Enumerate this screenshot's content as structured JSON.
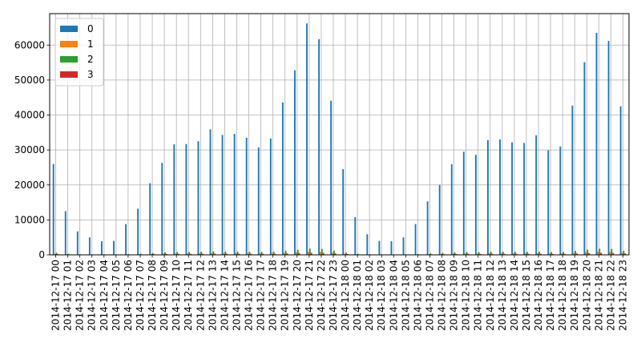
{
  "chart_data": {
    "type": "bar",
    "title": "",
    "xlabel": "",
    "ylabel": "",
    "ylim": [
      0,
      69000
    ],
    "y_ticks": [
      0,
      10000,
      20000,
      30000,
      40000,
      50000,
      60000
    ],
    "grid": true,
    "legend_position": "top-left",
    "categories": [
      "2014-12-17 00",
      "2014-12-17 01",
      "2014-12-17 02",
      "2014-12-17 03",
      "2014-12-17 04",
      "2014-12-17 05",
      "2014-12-17 06",
      "2014-12-17 07",
      "2014-12-17 08",
      "2014-12-17 09",
      "2014-12-17 10",
      "2014-12-17 11",
      "2014-12-17 12",
      "2014-12-17 13",
      "2014-12-17 14",
      "2014-12-17 15",
      "2014-12-17 16",
      "2014-12-17 17",
      "2014-12-17 18",
      "2014-12-17 19",
      "2014-12-17 20",
      "2014-12-17 21",
      "2014-12-17 22",
      "2014-12-17 23",
      "2014-12-18 00",
      "2014-12-18 01",
      "2014-12-18 02",
      "2014-12-18 03",
      "2014-12-18 04",
      "2014-12-18 05",
      "2014-12-18 06",
      "2014-12-18 07",
      "2014-12-18 08",
      "2014-12-18 09",
      "2014-12-18 10",
      "2014-12-18 11",
      "2014-12-18 12",
      "2014-12-18 13",
      "2014-12-18 14",
      "2014-12-18 15",
      "2014-12-18 16",
      "2014-12-18 17",
      "2014-12-18 18",
      "2014-12-18 19",
      "2014-12-18 20",
      "2014-12-18 21",
      "2014-12-18 22",
      "2014-12-18 23"
    ],
    "series": [
      {
        "name": "0",
        "color": "#1f77b4",
        "values": [
          26000,
          12500,
          6700,
          5000,
          3900,
          4000,
          8800,
          13200,
          20500,
          26300,
          31600,
          31700,
          32500,
          35900,
          34300,
          34600,
          33500,
          30700,
          33300,
          43600,
          52800,
          66200,
          61700,
          44100,
          24500,
          10800,
          5900,
          4000,
          3900,
          5000,
          8800,
          15300,
          20000,
          25900,
          29500,
          28600,
          32800,
          33000,
          32200,
          32000,
          34200,
          29900,
          31000,
          42700,
          55100,
          63500,
          61200,
          42500
        ]
      },
      {
        "name": "1",
        "color": "#ff7f0e",
        "values": [
          300,
          150,
          80,
          60,
          50,
          60,
          100,
          150,
          250,
          350,
          400,
          420,
          450,
          500,
          480,
          470,
          450,
          420,
          450,
          600,
          750,
          900,
          850,
          600,
          320,
          140,
          80,
          50,
          50,
          60,
          110,
          200,
          280,
          350,
          400,
          380,
          440,
          450,
          430,
          430,
          460,
          400,
          420,
          580,
          760,
          880,
          840,
          580
        ]
      },
      {
        "name": "2",
        "color": "#2ca02c",
        "values": [
          600,
          300,
          150,
          120,
          100,
          100,
          200,
          300,
          500,
          700,
          800,
          850,
          900,
          1000,
          950,
          950,
          900,
          850,
          900,
          1200,
          1450,
          1800,
          1700,
          1200,
          650,
          280,
          150,
          100,
          100,
          120,
          220,
          400,
          550,
          700,
          800,
          780,
          880,
          900,
          870,
          860,
          920,
          800,
          840,
          1150,
          1500,
          1750,
          1680,
          1150
        ]
      },
      {
        "name": "3",
        "color": "#d62728",
        "values": [
          200,
          100,
          50,
          40,
          30,
          35,
          70,
          100,
          170,
          230,
          280,
          290,
          300,
          330,
          320,
          320,
          300,
          290,
          300,
          400,
          490,
          600,
          570,
          400,
          220,
          95,
          50,
          35,
          35,
          40,
          75,
          130,
          180,
          230,
          270,
          260,
          300,
          300,
          290,
          290,
          310,
          270,
          280,
          390,
          500,
          580,
          560,
          390
        ]
      }
    ]
  }
}
